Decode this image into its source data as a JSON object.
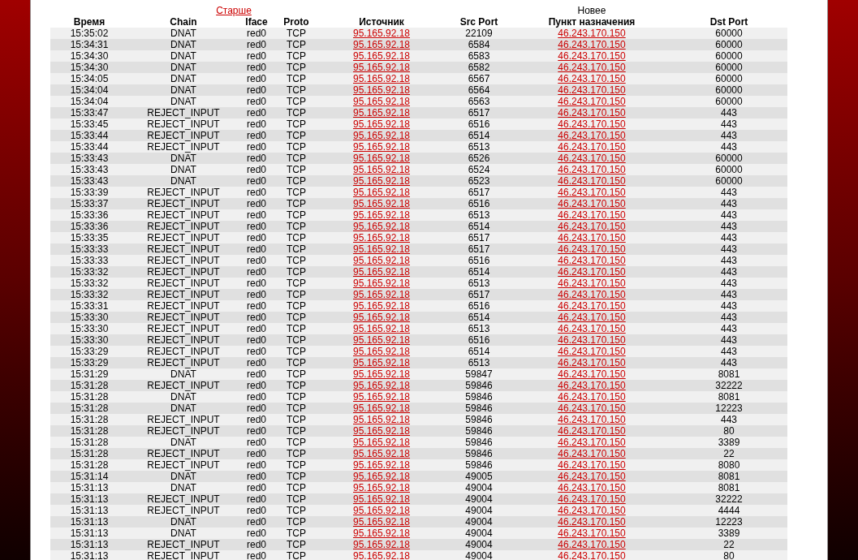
{
  "nav": {
    "older": "Старше",
    "newer": "Новее"
  },
  "table": {
    "columns": [
      "Время",
      "Chain",
      "Iface",
      "Proto",
      "Источник",
      "Src Port",
      "Пункт назначения",
      "Dst Port"
    ],
    "rows": [
      {
        "time": "15:35:02",
        "chain": "DNAT",
        "iface": "red0",
        "proto": "TCP",
        "source": "95.165.92.18",
        "src_port": "22109",
        "destination": "46.243.170.150",
        "dst_port": "60000"
      },
      {
        "time": "15:34:31",
        "chain": "DNAT",
        "iface": "red0",
        "proto": "TCP",
        "source": "95.165.92.18",
        "src_port": "6584",
        "destination": "46.243.170.150",
        "dst_port": "60000"
      },
      {
        "time": "15:34:30",
        "chain": "DNAT",
        "iface": "red0",
        "proto": "TCP",
        "source": "95.165.92.18",
        "src_port": "6583",
        "destination": "46.243.170.150",
        "dst_port": "60000"
      },
      {
        "time": "15:34:30",
        "chain": "DNAT",
        "iface": "red0",
        "proto": "TCP",
        "source": "95.165.92.18",
        "src_port": "6582",
        "destination": "46.243.170.150",
        "dst_port": "60000"
      },
      {
        "time": "15:34:05",
        "chain": "DNAT",
        "iface": "red0",
        "proto": "TCP",
        "source": "95.165.92.18",
        "src_port": "6567",
        "destination": "46.243.170.150",
        "dst_port": "60000"
      },
      {
        "time": "15:34:04",
        "chain": "DNAT",
        "iface": "red0",
        "proto": "TCP",
        "source": "95.165.92.18",
        "src_port": "6564",
        "destination": "46.243.170.150",
        "dst_port": "60000"
      },
      {
        "time": "15:34:04",
        "chain": "DNAT",
        "iface": "red0",
        "proto": "TCP",
        "source": "95.165.92.18",
        "src_port": "6563",
        "destination": "46.243.170.150",
        "dst_port": "60000"
      },
      {
        "time": "15:33:47",
        "chain": "REJECT_INPUT",
        "iface": "red0",
        "proto": "TCP",
        "source": "95.165.92.18",
        "src_port": "6517",
        "destination": "46.243.170.150",
        "dst_port": "443"
      },
      {
        "time": "15:33:45",
        "chain": "REJECT_INPUT",
        "iface": "red0",
        "proto": "TCP",
        "source": "95.165.92.18",
        "src_port": "6516",
        "destination": "46.243.170.150",
        "dst_port": "443"
      },
      {
        "time": "15:33:44",
        "chain": "REJECT_INPUT",
        "iface": "red0",
        "proto": "TCP",
        "source": "95.165.92.18",
        "src_port": "6514",
        "destination": "46.243.170.150",
        "dst_port": "443"
      },
      {
        "time": "15:33:44",
        "chain": "REJECT_INPUT",
        "iface": "red0",
        "proto": "TCP",
        "source": "95.165.92.18",
        "src_port": "6513",
        "destination": "46.243.170.150",
        "dst_port": "443"
      },
      {
        "time": "15:33:43",
        "chain": "DNAT",
        "iface": "red0",
        "proto": "TCP",
        "source": "95.165.92.18",
        "src_port": "6526",
        "destination": "46.243.170.150",
        "dst_port": "60000"
      },
      {
        "time": "15:33:43",
        "chain": "DNAT",
        "iface": "red0",
        "proto": "TCP",
        "source": "95.165.92.18",
        "src_port": "6524",
        "destination": "46.243.170.150",
        "dst_port": "60000"
      },
      {
        "time": "15:33:43",
        "chain": "DNAT",
        "iface": "red0",
        "proto": "TCP",
        "source": "95.165.92.18",
        "src_port": "6523",
        "destination": "46.243.170.150",
        "dst_port": "60000"
      },
      {
        "time": "15:33:39",
        "chain": "REJECT_INPUT",
        "iface": "red0",
        "proto": "TCP",
        "source": "95.165.92.18",
        "src_port": "6517",
        "destination": "46.243.170.150",
        "dst_port": "443"
      },
      {
        "time": "15:33:37",
        "chain": "REJECT_INPUT",
        "iface": "red0",
        "proto": "TCP",
        "source": "95.165.92.18",
        "src_port": "6516",
        "destination": "46.243.170.150",
        "dst_port": "443"
      },
      {
        "time": "15:33:36",
        "chain": "REJECT_INPUT",
        "iface": "red0",
        "proto": "TCP",
        "source": "95.165.92.18",
        "src_port": "6513",
        "destination": "46.243.170.150",
        "dst_port": "443"
      },
      {
        "time": "15:33:36",
        "chain": "REJECT_INPUT",
        "iface": "red0",
        "proto": "TCP",
        "source": "95.165.92.18",
        "src_port": "6514",
        "destination": "46.243.170.150",
        "dst_port": "443"
      },
      {
        "time": "15:33:35",
        "chain": "REJECT_INPUT",
        "iface": "red0",
        "proto": "TCP",
        "source": "95.165.92.18",
        "src_port": "6517",
        "destination": "46.243.170.150",
        "dst_port": "443"
      },
      {
        "time": "15:33:33",
        "chain": "REJECT_INPUT",
        "iface": "red0",
        "proto": "TCP",
        "source": "95.165.92.18",
        "src_port": "6517",
        "destination": "46.243.170.150",
        "dst_port": "443"
      },
      {
        "time": "15:33:33",
        "chain": "REJECT_INPUT",
        "iface": "red0",
        "proto": "TCP",
        "source": "95.165.92.18",
        "src_port": "6516",
        "destination": "46.243.170.150",
        "dst_port": "443"
      },
      {
        "time": "15:33:32",
        "chain": "REJECT_INPUT",
        "iface": "red0",
        "proto": "TCP",
        "source": "95.165.92.18",
        "src_port": "6514",
        "destination": "46.243.170.150",
        "dst_port": "443"
      },
      {
        "time": "15:33:32",
        "chain": "REJECT_INPUT",
        "iface": "red0",
        "proto": "TCP",
        "source": "95.165.92.18",
        "src_port": "6513",
        "destination": "46.243.170.150",
        "dst_port": "443"
      },
      {
        "time": "15:33:32",
        "chain": "REJECT_INPUT",
        "iface": "red0",
        "proto": "TCP",
        "source": "95.165.92.18",
        "src_port": "6517",
        "destination": "46.243.170.150",
        "dst_port": "443"
      },
      {
        "time": "15:33:31",
        "chain": "REJECT_INPUT",
        "iface": "red0",
        "proto": "TCP",
        "source": "95.165.92.18",
        "src_port": "6516",
        "destination": "46.243.170.150",
        "dst_port": "443"
      },
      {
        "time": "15:33:30",
        "chain": "REJECT_INPUT",
        "iface": "red0",
        "proto": "TCP",
        "source": "95.165.92.18",
        "src_port": "6514",
        "destination": "46.243.170.150",
        "dst_port": "443"
      },
      {
        "time": "15:33:30",
        "chain": "REJECT_INPUT",
        "iface": "red0",
        "proto": "TCP",
        "source": "95.165.92.18",
        "src_port": "6513",
        "destination": "46.243.170.150",
        "dst_port": "443"
      },
      {
        "time": "15:33:30",
        "chain": "REJECT_INPUT",
        "iface": "red0",
        "proto": "TCP",
        "source": "95.165.92.18",
        "src_port": "6516",
        "destination": "46.243.170.150",
        "dst_port": "443"
      },
      {
        "time": "15:33:29",
        "chain": "REJECT_INPUT",
        "iface": "red0",
        "proto": "TCP",
        "source": "95.165.92.18",
        "src_port": "6514",
        "destination": "46.243.170.150",
        "dst_port": "443"
      },
      {
        "time": "15:33:29",
        "chain": "REJECT_INPUT",
        "iface": "red0",
        "proto": "TCP",
        "source": "95.165.92.18",
        "src_port": "6513",
        "destination": "46.243.170.150",
        "dst_port": "443"
      },
      {
        "time": "15:31:29",
        "chain": "DNAT",
        "iface": "red0",
        "proto": "TCP",
        "source": "95.165.92.18",
        "src_port": "59847",
        "destination": "46.243.170.150",
        "dst_port": "8081"
      },
      {
        "time": "15:31:28",
        "chain": "REJECT_INPUT",
        "iface": "red0",
        "proto": "TCP",
        "source": "95.165.92.18",
        "src_port": "59846",
        "destination": "46.243.170.150",
        "dst_port": "32222"
      },
      {
        "time": "15:31:28",
        "chain": "DNAT",
        "iface": "red0",
        "proto": "TCP",
        "source": "95.165.92.18",
        "src_port": "59846",
        "destination": "46.243.170.150",
        "dst_port": "8081"
      },
      {
        "time": "15:31:28",
        "chain": "DNAT",
        "iface": "red0",
        "proto": "TCP",
        "source": "95.165.92.18",
        "src_port": "59846",
        "destination": "46.243.170.150",
        "dst_port": "12223"
      },
      {
        "time": "15:31:28",
        "chain": "REJECT_INPUT",
        "iface": "red0",
        "proto": "TCP",
        "source": "95.165.92.18",
        "src_port": "59846",
        "destination": "46.243.170.150",
        "dst_port": "443"
      },
      {
        "time": "15:31:28",
        "chain": "REJECT_INPUT",
        "iface": "red0",
        "proto": "TCP",
        "source": "95.165.92.18",
        "src_port": "59846",
        "destination": "46.243.170.150",
        "dst_port": "80"
      },
      {
        "time": "15:31:28",
        "chain": "DNAT",
        "iface": "red0",
        "proto": "TCP",
        "source": "95.165.92.18",
        "src_port": "59846",
        "destination": "46.243.170.150",
        "dst_port": "3389"
      },
      {
        "time": "15:31:28",
        "chain": "REJECT_INPUT",
        "iface": "red0",
        "proto": "TCP",
        "source": "95.165.92.18",
        "src_port": "59846",
        "destination": "46.243.170.150",
        "dst_port": "22"
      },
      {
        "time": "15:31:28",
        "chain": "REJECT_INPUT",
        "iface": "red0",
        "proto": "TCP",
        "source": "95.165.92.18",
        "src_port": "59846",
        "destination": "46.243.170.150",
        "dst_port": "8080"
      },
      {
        "time": "15:31:14",
        "chain": "DNAT",
        "iface": "red0",
        "proto": "TCP",
        "source": "95.165.92.18",
        "src_port": "49005",
        "destination": "46.243.170.150",
        "dst_port": "8081"
      },
      {
        "time": "15:31:13",
        "chain": "DNAT",
        "iface": "red0",
        "proto": "TCP",
        "source": "95.165.92.18",
        "src_port": "49004",
        "destination": "46.243.170.150",
        "dst_port": "8081"
      },
      {
        "time": "15:31:13",
        "chain": "REJECT_INPUT",
        "iface": "red0",
        "proto": "TCP",
        "source": "95.165.92.18",
        "src_port": "49004",
        "destination": "46.243.170.150",
        "dst_port": "32222"
      },
      {
        "time": "15:31:13",
        "chain": "REJECT_INPUT",
        "iface": "red0",
        "proto": "TCP",
        "source": "95.165.92.18",
        "src_port": "49004",
        "destination": "46.243.170.150",
        "dst_port": "4444"
      },
      {
        "time": "15:31:13",
        "chain": "DNAT",
        "iface": "red0",
        "proto": "TCP",
        "source": "95.165.92.18",
        "src_port": "49004",
        "destination": "46.243.170.150",
        "dst_port": "12223"
      },
      {
        "time": "15:31:13",
        "chain": "DNAT",
        "iface": "red0",
        "proto": "TCP",
        "source": "95.165.92.18",
        "src_port": "49004",
        "destination": "46.243.170.150",
        "dst_port": "3389"
      },
      {
        "time": "15:31:13",
        "chain": "REJECT_INPUT",
        "iface": "red0",
        "proto": "TCP",
        "source": "95.165.92.18",
        "src_port": "49004",
        "destination": "46.243.170.150",
        "dst_port": "22"
      },
      {
        "time": "15:31:13",
        "chain": "REJECT_INPUT",
        "iface": "red0",
        "proto": "TCP",
        "source": "95.165.92.18",
        "src_port": "49004",
        "destination": "46.243.170.150",
        "dst_port": "80"
      }
    ]
  }
}
